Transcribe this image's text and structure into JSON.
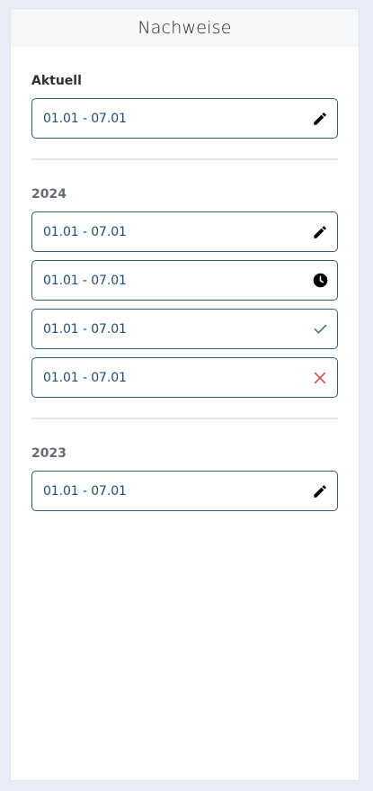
{
  "header": {
    "title": "Nachweise"
  },
  "current": {
    "title": "Aktuell",
    "items": [
      {
        "label": "01.01 - 07.01",
        "status": "edit",
        "icon": "pencil-icon",
        "color": "#000000"
      }
    ]
  },
  "years": [
    {
      "title": "2024",
      "items": [
        {
          "label": "01.01 - 07.01",
          "status": "edit",
          "icon": "pencil-icon",
          "color": "#000000"
        },
        {
          "label": "01.01 - 07.01",
          "status": "pending",
          "icon": "clock-icon",
          "color": "#000000"
        },
        {
          "label": "01.01 - 07.01",
          "status": "approved",
          "icon": "check-icon",
          "color": "#2e7d4f"
        },
        {
          "label": "01.01 - 07.01",
          "status": "rejected",
          "icon": "cross-icon",
          "color": "#d9363e"
        }
      ]
    },
    {
      "title": "2023",
      "items": [
        {
          "label": "01.01 - 07.01",
          "status": "edit",
          "icon": "pencil-icon",
          "color": "#000000"
        }
      ]
    }
  ]
}
